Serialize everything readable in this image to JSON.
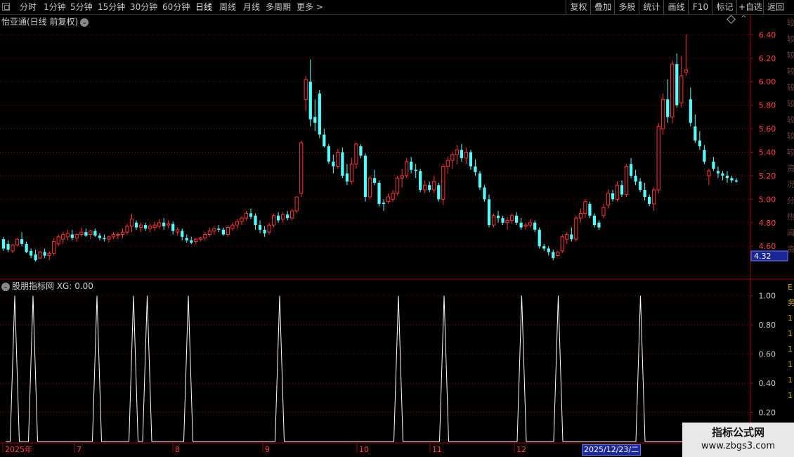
{
  "toolbar": {
    "periods": [
      "分时",
      "1分钟",
      "5分钟",
      "15分钟",
      "30分钟",
      "60分钟",
      "日线",
      "周线",
      "月线",
      "多周期",
      "更多 >"
    ],
    "active_period": "日线",
    "right_buttons": [
      "复权",
      "叠加",
      "多股",
      "统计",
      "画线",
      "F10",
      "标记",
      "+自选",
      "返回"
    ]
  },
  "main_title": "怡亚通(日线 前复权)",
  "indicator_title": "股朋指标网 XG: 0.00",
  "price_axis": [
    "6.40",
    "6.20",
    "6.00",
    "5.80",
    "5.60",
    "5.40",
    "5.20",
    "5.00",
    "4.80",
    "4.60"
  ],
  "price_marker": "4.32",
  "indicator_axis": [
    "1.00",
    "0.80",
    "0.60",
    "0.40",
    "0.20"
  ],
  "date_axis": [
    "2025年",
    "7",
    "8",
    "9",
    "10",
    "11",
    "12"
  ],
  "date_highlight": "2025/12/23/二",
  "watermark": {
    "line1": "指标公式网",
    "line2": "www.zbgs3.com"
  },
  "colors": {
    "up": "#ff3232",
    "down": "#54ffff",
    "grid": "#8b0000",
    "indicator": "#ffffff",
    "axis_text": "#ff4040"
  },
  "chart_data": [
    {
      "type": "candlestick",
      "ylim": [
        4.32,
        6.48
      ],
      "x_month_labels": [
        "2025年",
        "7",
        "8",
        "9",
        "10",
        "11",
        "12"
      ],
      "ohlc": [
        [
          4.66,
          4.68,
          4.56,
          4.58
        ],
        [
          4.62,
          4.65,
          4.55,
          4.57
        ],
        [
          4.56,
          4.62,
          4.54,
          4.61
        ],
        [
          4.61,
          4.67,
          4.6,
          4.66
        ],
        [
          4.66,
          4.72,
          4.6,
          4.62
        ],
        [
          4.62,
          4.64,
          4.54,
          4.55
        ],
        [
          4.56,
          4.58,
          4.5,
          4.52
        ],
        [
          4.53,
          4.57,
          4.47,
          4.48
        ],
        [
          4.5,
          4.56,
          4.49,
          4.55
        ],
        [
          4.55,
          4.58,
          4.5,
          4.52
        ],
        [
          4.52,
          4.56,
          4.48,
          4.54
        ],
        [
          4.54,
          4.67,
          4.52,
          4.64
        ],
        [
          4.62,
          4.7,
          4.6,
          4.68
        ],
        [
          4.66,
          4.72,
          4.62,
          4.7
        ],
        [
          4.68,
          4.74,
          4.65,
          4.71
        ],
        [
          4.7,
          4.74,
          4.65,
          4.67
        ],
        [
          4.67,
          4.71,
          4.64,
          4.7
        ],
        [
          4.7,
          4.76,
          4.68,
          4.72
        ],
        [
          4.72,
          4.75,
          4.68,
          4.69
        ],
        [
          4.7,
          4.74,
          4.66,
          4.73
        ],
        [
          4.73,
          4.75,
          4.68,
          4.69
        ],
        [
          4.69,
          4.71,
          4.65,
          4.67
        ],
        [
          4.67,
          4.7,
          4.64,
          4.66
        ],
        [
          4.66,
          4.69,
          4.63,
          4.68
        ],
        [
          4.68,
          4.72,
          4.66,
          4.7
        ],
        [
          4.7,
          4.72,
          4.66,
          4.7
        ],
        [
          4.7,
          4.75,
          4.67,
          4.72
        ],
        [
          4.72,
          4.79,
          4.7,
          4.77
        ],
        [
          4.77,
          4.88,
          4.72,
          4.83
        ],
        [
          4.8,
          4.82,
          4.74,
          4.76
        ],
        [
          4.76,
          4.8,
          4.72,
          4.78
        ],
        [
          4.78,
          4.8,
          4.73,
          4.75
        ],
        [
          4.75,
          4.79,
          4.72,
          4.77
        ],
        [
          4.76,
          4.81,
          4.73,
          4.78
        ],
        [
          4.77,
          4.83,
          4.75,
          4.8
        ],
        [
          4.8,
          4.84,
          4.74,
          4.77
        ],
        [
          4.78,
          4.82,
          4.75,
          4.79
        ],
        [
          4.79,
          4.81,
          4.7,
          4.73
        ],
        [
          4.72,
          4.76,
          4.69,
          4.74
        ],
        [
          4.73,
          4.75,
          4.65,
          4.68
        ],
        [
          4.67,
          4.7,
          4.63,
          4.65
        ],
        [
          4.65,
          4.68,
          4.62,
          4.63
        ],
        [
          4.64,
          4.67,
          4.62,
          4.66
        ],
        [
          4.66,
          4.68,
          4.64,
          4.67
        ],
        [
          4.67,
          4.72,
          4.65,
          4.7
        ],
        [
          4.7,
          4.76,
          4.68,
          4.73
        ],
        [
          4.73,
          4.77,
          4.7,
          4.75
        ],
        [
          4.75,
          4.78,
          4.72,
          4.74
        ],
        [
          4.74,
          4.76,
          4.69,
          4.7
        ],
        [
          4.7,
          4.78,
          4.68,
          4.76
        ],
        [
          4.75,
          4.8,
          4.73,
          4.78
        ],
        [
          4.78,
          4.83,
          4.75,
          4.81
        ],
        [
          4.81,
          4.86,
          4.78,
          4.84
        ],
        [
          4.84,
          4.9,
          4.82,
          4.88
        ],
        [
          4.88,
          4.92,
          4.83,
          4.85
        ],
        [
          4.86,
          4.88,
          4.74,
          4.78
        ],
        [
          4.78,
          4.82,
          4.71,
          4.74
        ],
        [
          4.74,
          4.77,
          4.68,
          4.71
        ],
        [
          4.72,
          4.8,
          4.7,
          4.78
        ],
        [
          4.78,
          4.88,
          4.76,
          4.86
        ],
        [
          4.86,
          4.89,
          4.8,
          4.82
        ],
        [
          4.83,
          4.89,
          4.8,
          4.87
        ],
        [
          4.87,
          4.9,
          4.82,
          4.84
        ],
        [
          4.84,
          4.92,
          4.82,
          4.9
        ],
        [
          4.9,
          4.99,
          4.88,
          5.02
        ],
        [
          5.05,
          5.5,
          5.02,
          5.48
        ],
        [
          5.85,
          6.05,
          5.75,
          6.02
        ],
        [
          6.0,
          6.19,
          5.62,
          5.68
        ],
        [
          5.7,
          5.85,
          5.58,
          5.65
        ],
        [
          5.9,
          5.93,
          5.52,
          5.55
        ],
        [
          5.55,
          5.6,
          5.44,
          5.45
        ],
        [
          5.45,
          5.47,
          5.3,
          5.32
        ],
        [
          5.32,
          5.38,
          5.22,
          5.28
        ],
        [
          5.28,
          5.43,
          5.26,
          5.4
        ],
        [
          5.4,
          5.44,
          5.18,
          5.2
        ],
        [
          5.22,
          5.3,
          5.12,
          5.15
        ],
        [
          5.15,
          5.35,
          5.13,
          5.3
        ],
        [
          5.3,
          5.48,
          5.26,
          5.47
        ],
        [
          5.45,
          5.47,
          5.35,
          5.37
        ],
        [
          5.37,
          5.39,
          4.98,
          5.02
        ],
        [
          5.02,
          5.2,
          5.0,
          5.18
        ],
        [
          5.18,
          5.25,
          5.12,
          5.14
        ],
        [
          5.14,
          5.16,
          4.94,
          4.96
        ],
        [
          4.97,
          5.0,
          4.9,
          4.96
        ],
        [
          4.98,
          5.05,
          4.96,
          5.02
        ],
        [
          5.0,
          5.08,
          4.98,
          5.05
        ],
        [
          5.05,
          5.2,
          5.03,
          5.18
        ],
        [
          5.18,
          5.26,
          5.1,
          5.2
        ],
        [
          5.2,
          5.35,
          5.18,
          5.32
        ],
        [
          5.32,
          5.36,
          5.22,
          5.25
        ],
        [
          5.25,
          5.3,
          5.18,
          5.24
        ],
        [
          5.24,
          5.26,
          5.06,
          5.08
        ],
        [
          5.08,
          5.16,
          5.05,
          5.12
        ],
        [
          5.12,
          5.15,
          5.06,
          5.08
        ],
        [
          5.08,
          5.2,
          5.05,
          5.15
        ],
        [
          5.12,
          5.14,
          4.98,
          5.0
        ],
        [
          5.0,
          5.3,
          4.95,
          5.28
        ],
        [
          5.28,
          5.36,
          5.22,
          5.33
        ],
        [
          5.33,
          5.4,
          5.26,
          5.38
        ],
        [
          5.38,
          5.46,
          5.3,
          5.42
        ],
        [
          5.42,
          5.47,
          5.32,
          5.35
        ],
        [
          5.35,
          5.44,
          5.3,
          5.4
        ],
        [
          5.4,
          5.42,
          5.25,
          5.28
        ],
        [
          5.28,
          5.34,
          5.2,
          5.23
        ],
        [
          5.22,
          5.24,
          5.08,
          5.1
        ],
        [
          5.1,
          5.12,
          4.98,
          5.0
        ],
        [
          5.0,
          5.04,
          4.76,
          4.78
        ],
        [
          4.78,
          4.88,
          4.76,
          4.86
        ],
        [
          4.86,
          4.9,
          4.8,
          4.84
        ],
        [
          4.84,
          4.86,
          4.78,
          4.8
        ],
        [
          4.8,
          4.85,
          4.74,
          4.82
        ],
        [
          4.82,
          4.88,
          4.79,
          4.86
        ],
        [
          4.86,
          4.89,
          4.78,
          4.8
        ],
        [
          4.8,
          4.84,
          4.74,
          4.76
        ],
        [
          4.77,
          4.8,
          4.74,
          4.78
        ],
        [
          4.78,
          4.83,
          4.76,
          4.8
        ],
        [
          4.8,
          4.82,
          4.72,
          4.74
        ],
        [
          4.74,
          4.76,
          4.58,
          4.6
        ],
        [
          4.6,
          4.62,
          4.56,
          4.58
        ],
        [
          4.58,
          4.6,
          4.52,
          4.55
        ],
        [
          4.55,
          4.57,
          4.48,
          4.5
        ],
        [
          4.52,
          4.56,
          4.51,
          4.55
        ],
        [
          4.56,
          4.7,
          4.54,
          4.68
        ],
        [
          4.66,
          4.72,
          4.62,
          4.7
        ],
        [
          4.7,
          4.76,
          4.64,
          4.66
        ],
        [
          4.66,
          4.86,
          4.64,
          4.84
        ],
        [
          4.84,
          4.92,
          4.8,
          4.88
        ],
        [
          4.88,
          5.0,
          4.84,
          4.98
        ],
        [
          4.96,
          4.98,
          4.84,
          4.86
        ],
        [
          4.86,
          4.88,
          4.76,
          4.78
        ],
        [
          4.8,
          4.82,
          4.74,
          4.76
        ],
        [
          4.86,
          4.96,
          4.84,
          4.93
        ],
        [
          4.95,
          5.08,
          4.92,
          5.05
        ],
        [
          5.05,
          5.08,
          4.98,
          5.0
        ],
        [
          5.0,
          5.15,
          4.98,
          5.12
        ],
        [
          5.12,
          5.16,
          5.02,
          5.04
        ],
        [
          5.04,
          5.3,
          5.02,
          5.28
        ],
        [
          5.3,
          5.35,
          5.18,
          5.2
        ],
        [
          5.2,
          5.25,
          5.12,
          5.15
        ],
        [
          5.15,
          5.18,
          5.06,
          5.08
        ],
        [
          5.08,
          5.14,
          4.99,
          5.02
        ],
        [
          5.02,
          5.04,
          4.94,
          4.96
        ],
        [
          4.96,
          5.1,
          4.9,
          5.08
        ],
        [
          5.08,
          5.65,
          5.05,
          5.62
        ],
        [
          5.6,
          5.9,
          5.55,
          5.85
        ],
        [
          5.85,
          6.02,
          5.65,
          5.7
        ],
        [
          5.7,
          6.18,
          5.65,
          6.15
        ],
        [
          6.15,
          6.24,
          5.78,
          5.8
        ],
        [
          5.82,
          6.22,
          5.78,
          6.05
        ],
        [
          6.08,
          6.4,
          6.05,
          6.1
        ],
        [
          5.85,
          5.95,
          5.62,
          5.65
        ],
        [
          5.62,
          5.72,
          5.48,
          5.5
        ],
        [
          5.5,
          5.58,
          5.42,
          5.45
        ],
        [
          5.42,
          5.46,
          5.3,
          5.32
        ],
        [
          5.2,
          5.26,
          5.12,
          5.24
        ],
        [
          5.32,
          5.36,
          5.24,
          5.26
        ],
        [
          5.24,
          5.28,
          5.18,
          5.22
        ],
        [
          5.22,
          5.24,
          5.16,
          5.2
        ],
        [
          5.2,
          5.24,
          5.14,
          5.18
        ],
        [
          5.18,
          5.2,
          5.14,
          5.16
        ],
        [
          5.16,
          5.18,
          5.14,
          5.15
        ]
      ]
    },
    {
      "type": "line",
      "title": "XG",
      "ylim": [
        0,
        1.1
      ],
      "signal_days": [
        1,
        5,
        17,
        23,
        25,
        34,
        49,
        72,
        80,
        94,
        101,
        115
      ]
    }
  ]
}
